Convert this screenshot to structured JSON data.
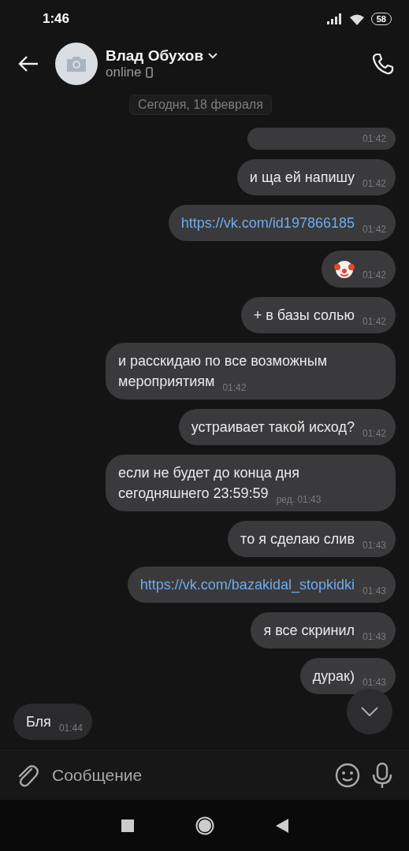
{
  "status_bar": {
    "time": "1:46",
    "battery": "58"
  },
  "header": {
    "name": "Влад Обухов",
    "status": "online"
  },
  "date_chip": "Сегодня, 18 февраля",
  "messages": [
    {
      "kind": "cut",
      "incoming": false,
      "time": "01:42"
    },
    {
      "kind": "text",
      "incoming": false,
      "text": "и ща ей напишу",
      "time": "01:42"
    },
    {
      "kind": "link",
      "incoming": false,
      "text": "https://vk.com/id197866185",
      "time": "01:42"
    },
    {
      "kind": "emoji",
      "incoming": false,
      "time": "01:42"
    },
    {
      "kind": "text",
      "incoming": false,
      "text": "+ в базы солью",
      "time": "01:42"
    },
    {
      "kind": "text",
      "incoming": false,
      "text": "и расскидаю по все возможным мероприятиям",
      "time": "01:42"
    },
    {
      "kind": "text",
      "incoming": false,
      "text": "устраивает такой исход?",
      "time": "01:42"
    },
    {
      "kind": "text",
      "incoming": false,
      "text": "если не будет до конца дня сегодняшнего 23:59:59",
      "time": "01:43",
      "edited": "ред."
    },
    {
      "kind": "text",
      "incoming": false,
      "text": "то я сделаю слив",
      "time": "01:43"
    },
    {
      "kind": "link",
      "incoming": false,
      "text": "https://vk.com/bazakidal_stopkidki",
      "time": "01:43"
    },
    {
      "kind": "text",
      "incoming": false,
      "text": "я все скринил",
      "time": "01:43"
    },
    {
      "kind": "text",
      "incoming": false,
      "text": "дурак)",
      "time": "01:43"
    },
    {
      "kind": "text",
      "incoming": true,
      "text": "Бля",
      "time": "01:44"
    }
  ],
  "composer": {
    "placeholder": "Сообщение"
  }
}
